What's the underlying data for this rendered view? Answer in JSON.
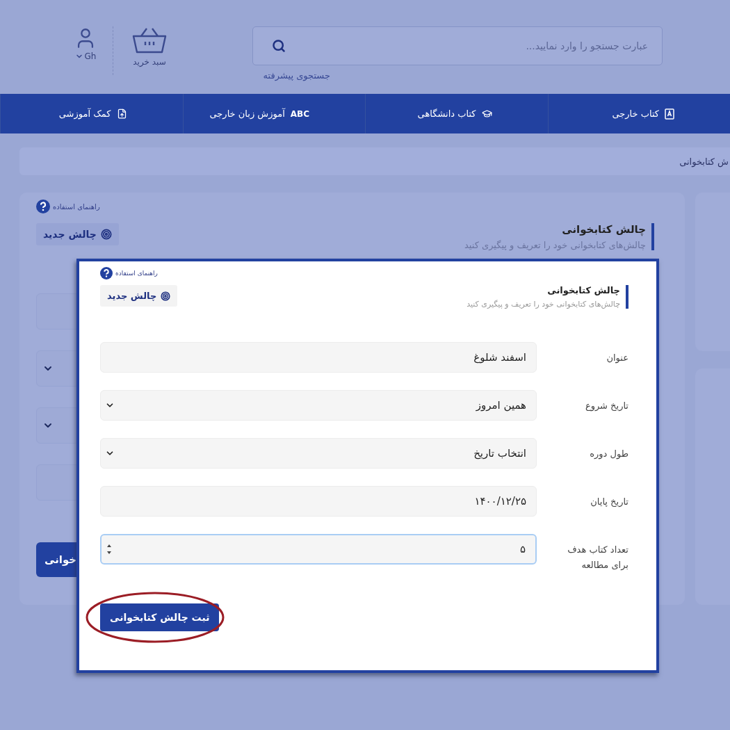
{
  "header": {
    "search": {
      "placeholder": "عبارت جستجو را وارد نمایید..."
    },
    "advanced_search": "جستجوی پیشرفته",
    "cart": {
      "label": "سبد خرید"
    },
    "user": {
      "label": "Gh"
    }
  },
  "nav": [
    {
      "label": "کتاب خارجی",
      "kind": "book"
    },
    {
      "label": "کتاب دانشگاهی",
      "kind": "cap"
    },
    {
      "label": "آموزش زبان خارجی",
      "kind": "abc",
      "badge": "ABC"
    },
    {
      "label": "کمک آموزشی",
      "kind": "upload"
    }
  ],
  "breadcrumb": "ش کتابخوانی",
  "background_card": {
    "help": "راهنمای استفاده",
    "title": "چالش کتابخوانی",
    "subtitle": "چالش‌های کتابخوانی خود را تعریف و پیگیری کنید",
    "new_button": "چالش جدید",
    "fields": [
      {
        "kind": "input"
      },
      {
        "kind": "select"
      },
      {
        "kind": "select"
      },
      {
        "kind": "input"
      }
    ],
    "submit_button": "خوانی"
  },
  "modal": {
    "help": "راهنمای استفاده",
    "title": "چالش کتابخوانی",
    "subtitle": "چالش‌های کتابخوانی خود را تعریف و پیگیری کنید",
    "new_button": "چالش جدید",
    "fields": [
      {
        "label": "عنوان",
        "value": "اسفند شلوغ",
        "kind": "input",
        "focused": false
      },
      {
        "label": "تاریخ شروع",
        "value": "همین امروز",
        "kind": "select",
        "focused": false
      },
      {
        "label": "طول دوره",
        "value": "انتخاب تاریخ",
        "kind": "select",
        "focused": false
      },
      {
        "label": "تاریخ پایان",
        "value": "۱۴۰۰/۱۲/۲۵",
        "kind": "input",
        "focused": false
      },
      {
        "label": "تعداد کتاب هدف برای مطالعه",
        "value": "۵",
        "kind": "number",
        "focused": true
      }
    ],
    "submit_button": {
      "label": "ثبت چالش کتابخوانی",
      "highlighted": true
    }
  }
}
